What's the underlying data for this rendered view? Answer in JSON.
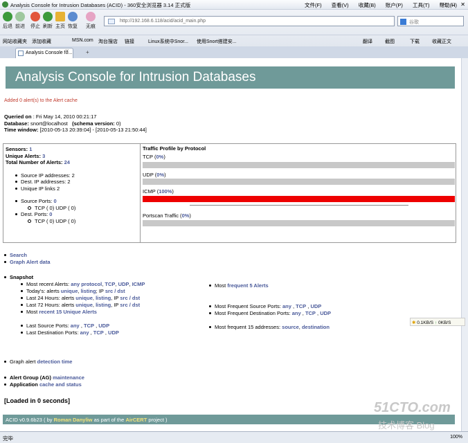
{
  "window": {
    "title": "Analysis Console for Intrusion Databases (ACID) - 360安全浏览器 3.14 正式版",
    "menus": [
      "文件(F)",
      "查看(V)",
      "收藏(B)",
      "账户(P)",
      "工具(T)",
      "帮助(H)"
    ]
  },
  "toolbar": {
    "back": "后退",
    "forward": "前进",
    "stop": "停止",
    "refresh": "刷新",
    "home": "主页",
    "restore": "恢复",
    "privacy": "无痕"
  },
  "address": {
    "url": "http://192.168.6.118/acid/acid_main.php"
  },
  "search": {
    "placeholder": "谷歌"
  },
  "bookmarks": [
    "网站收藏夹",
    "添加收藏",
    "MSN.com",
    "淘台搜店",
    "链接",
    "Linux系统中Snor...",
    "使用Snort搭建安..."
  ],
  "bookmarks_right": [
    "翻译",
    "截图",
    "下载",
    "收藏正文"
  ],
  "tab": {
    "label": "Analysis Console fo..."
  },
  "page": {
    "title": "Analysis Console for Intrusion Databases",
    "message": "Added 0 alert(s) to the Alert cache",
    "queried_label": "Queried on",
    "queried_value": ": Fri May 14, 2010 00:21:17",
    "database_label": "Database:",
    "database_value": "snort@localhost",
    "schema_label": "(schema version:",
    "schema_value": "0)",
    "time_label": "Time window:",
    "time_value": "[2010-05-13 20:39:04] - [2010-05-13 21:50:44]"
  },
  "stats": {
    "sensors_label": "Sensors:",
    "sensors": "1",
    "unique_label": "Unique Alerts:",
    "unique": "3",
    "total_label": "Total Number of Alerts:",
    "total": "24",
    "src_ip": "Source IP addresses: 2",
    "dst_ip": "Dest. IP addresses: 2",
    "ip_links": "Unique IP links 2",
    "src_ports_label": "Source Ports:",
    "src_ports": "0",
    "src_ports_sub": "TCP ( 0)  UDP ( 0)",
    "dst_ports_label": "Dest. Ports:",
    "dst_ports": "0",
    "dst_ports_sub": "TCP ( 0)  UDP ( 0)"
  },
  "traffic": {
    "title": "Traffic Profile by Protocol",
    "rows": [
      {
        "name": "TCP",
        "pct": "0%",
        "value": 0
      },
      {
        "name": "UDP",
        "pct": "0%",
        "value": 0
      },
      {
        "name": "ICMP",
        "pct": "100%",
        "value": 1
      },
      {
        "name": "Portscan Traffic",
        "pct": "0%",
        "value": 0
      }
    ]
  },
  "links": {
    "search": "Search",
    "graph_alert": "Graph Alert data",
    "snapshot": "Snapshot",
    "recent_label": "Most recent Alerts:",
    "any_protocol": "any protocol",
    "tcp": "TCP",
    "udp": "UDP",
    "icmp": "ICMP",
    "today_label": "Today's: alerts",
    "unique": "unique",
    "listing": "listing",
    "ip_label": "IP",
    "src_dst": "src / dst",
    "last24": "Last 24 Hours: alerts",
    "last72": "Last 72 Hours: alerts",
    "most_recent_label": "Most",
    "recent15": "recent 15 Unique Alerts",
    "last_src_ports": "Last Source Ports:",
    "last_dst_ports": "Last Destination Ports:",
    "any": "any",
    "most_label": "Most",
    "frequent5": "frequent 5 Alerts",
    "freq_src_ports": "Most Frequent Source Ports:",
    "freq_dst_ports": "Most Frequent Destination Ports:",
    "freq15": "Most frequent 15 addresses:",
    "source": "source",
    "destination": "destination",
    "graph_label": "Graph alert",
    "detection_time": "detection time",
    "ag_label": "Alert Group (AG)",
    "maintenance": "maintenance",
    "app_label": "Application",
    "cache_status": "cache and status"
  },
  "loaded": "[Loaded in 0 seconds]",
  "footer": {
    "version": "ACID v0.9.6b23 ( by",
    "author": "Roman Danyliw",
    "mid": "as part of the",
    "project": "AirCERT",
    "end": "project )"
  },
  "speed": {
    "down": "0.1KB/S",
    "up": "0KB/S"
  },
  "status": {
    "text": "完毕",
    "zoom": "100%"
  },
  "watermark": {
    "brand": "51CTO.com",
    "sub": "技术博客 Blog"
  }
}
